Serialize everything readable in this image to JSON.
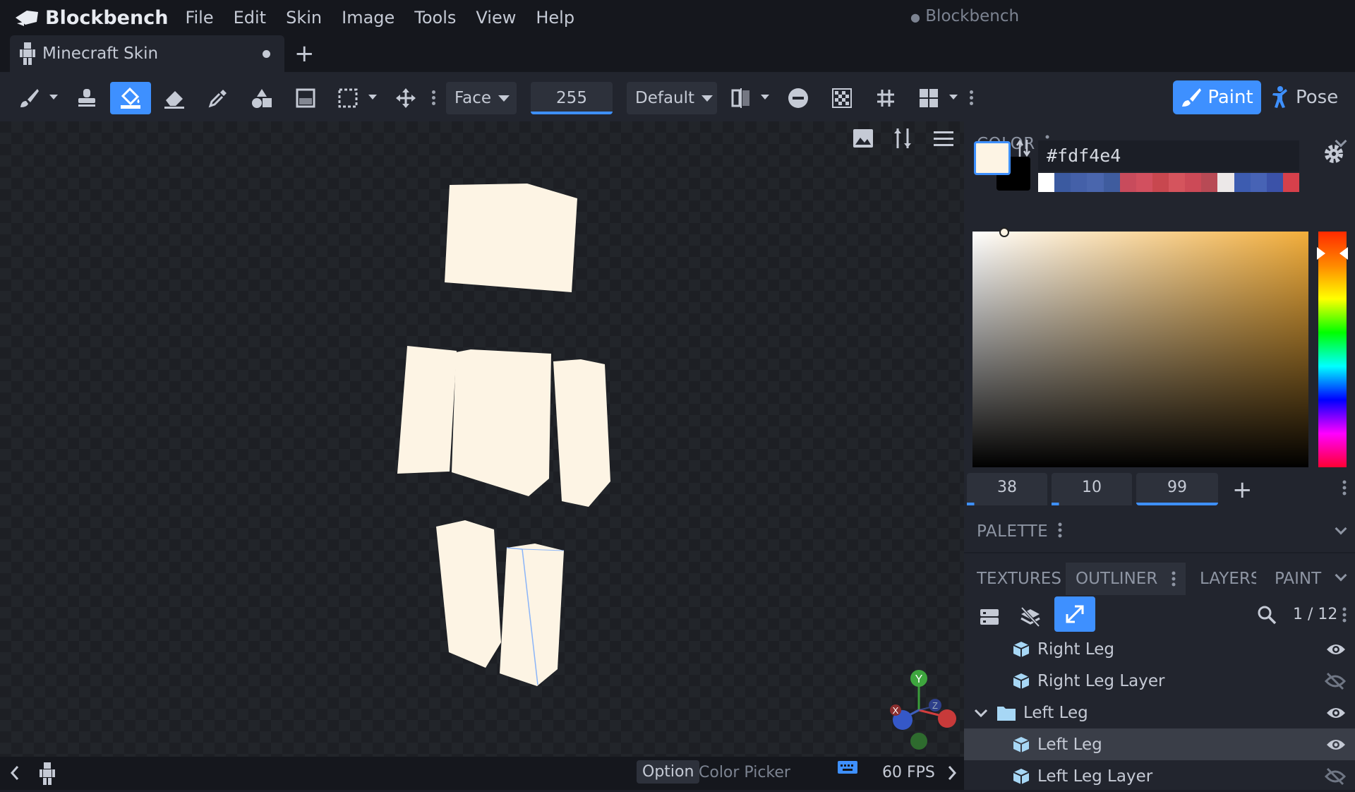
{
  "app": {
    "name": "Blockbench",
    "window_title": "Blockbench"
  },
  "menu": [
    "File",
    "Edit",
    "Skin",
    "Image",
    "Tools",
    "View",
    "Help"
  ],
  "tab": {
    "label": "Minecraft Skin",
    "unsaved": true
  },
  "toolbar": {
    "face_mode": "Face",
    "opacity": "255",
    "brush_shape": "Default",
    "paint_mode": "Paint",
    "pose_mode": "Pose"
  },
  "color_panel": {
    "title": "COLOR",
    "hex": "#fdf4e4",
    "primary_color": "#fdf4e4",
    "secondary_color": "#000000",
    "hsv": {
      "h": "38",
      "s": "10",
      "v": "99"
    },
    "swatch_colors": [
      "#ffffff",
      "#3b5aa0",
      "#4460a8",
      "#4a66ad",
      "#3f5c9e",
      "#c84b5c",
      "#d2505f",
      "#c8474f",
      "#d5545d",
      "#cc4a57",
      "#b84a55",
      "#ece8e8",
      "#3d5cb0",
      "#4763b5",
      "#3b52a8",
      "#d6404b"
    ]
  },
  "palette_panel": {
    "title": "PALETTE"
  },
  "panel_tabs": [
    "TEXTURES",
    "OUTLINER",
    "LAYERS",
    "PAINT"
  ],
  "outliner": {
    "count": "1 / 12",
    "rows": [
      {
        "label": "Right Leg",
        "type": "cube",
        "visible": true
      },
      {
        "label": "Right Leg Layer",
        "type": "cube",
        "visible": false
      },
      {
        "label": "Left Leg",
        "type": "group",
        "visible": true
      },
      {
        "label": "Left Leg",
        "type": "cube",
        "visible": true,
        "selected": true
      },
      {
        "label": "Left Leg Layer",
        "type": "cube",
        "visible": false
      }
    ]
  },
  "status": {
    "key": "Option",
    "action": "Color Picker",
    "fps": "60 FPS"
  }
}
